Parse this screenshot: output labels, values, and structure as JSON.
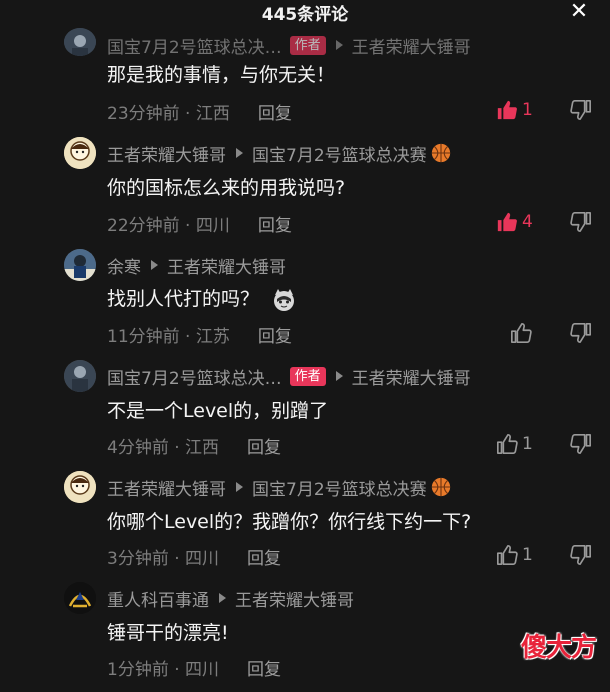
{
  "header": {
    "title": "445条评论",
    "close_label": "✕"
  },
  "colors": {
    "background": "#161616",
    "author_tag": "#e8365a",
    "liked": "#e8365a",
    "watermark": "#e8233a"
  },
  "comments": [
    {
      "user": "国宝7月2号篮球总决…",
      "is_author": true,
      "author_tag": "作者",
      "reply_to": "王者荣耀大锤哥",
      "text": "那是我的事情，与你无关！",
      "time": "23分钟前 · 江西",
      "reply_label": "回复",
      "likes": "1",
      "liked": true,
      "avatar_icon": "avatar-player-icon"
    },
    {
      "user": "王者荣耀大锤哥",
      "reply_to": "国宝7月2号篮球总决赛",
      "reply_to_emoji": "basketball-icon",
      "text": "你的国标怎么来的用我说吗?",
      "time": "22分钟前 · 四川",
      "reply_label": "回复",
      "likes": "4",
      "liked": true,
      "avatar_icon": "avatar-cartoon-icon"
    },
    {
      "user": "余寒",
      "reply_to": "王者荣耀大锤哥",
      "text": "找别人代打的吗？",
      "text_emoji": "cat-emoji-icon",
      "time": "11分钟前 · 江苏",
      "reply_label": "回复",
      "likes": "",
      "liked": false,
      "avatar_icon": "avatar-player-icon"
    },
    {
      "user": "国宝7月2号篮球总决…",
      "is_author": true,
      "author_tag": "作者",
      "reply_to": "王者荣耀大锤哥",
      "text": "不是一个Level的，别蹭了",
      "time": "4分钟前 · 江西",
      "reply_label": "回复",
      "likes": "1",
      "liked": false,
      "avatar_icon": "avatar-player-icon"
    },
    {
      "user": "王者荣耀大锤哥",
      "reply_to": "国宝7月2号篮球总决赛",
      "reply_to_emoji": "basketball-icon",
      "text": "你哪个Level的？我蹭你？你行线下约一下?",
      "time": "3分钟前 · 四川",
      "reply_label": "回复",
      "likes": "1",
      "liked": false,
      "avatar_icon": "avatar-cartoon-icon"
    },
    {
      "user": "重人科百事通",
      "reply_to": "王者荣耀大锤哥",
      "text": "锤哥干的漂亮!",
      "time": "1分钟前 · 四川",
      "reply_label": "回复",
      "likes": "",
      "liked": false,
      "avatar_icon": "avatar-team-logo-icon"
    }
  ],
  "watermark": "傻大方"
}
